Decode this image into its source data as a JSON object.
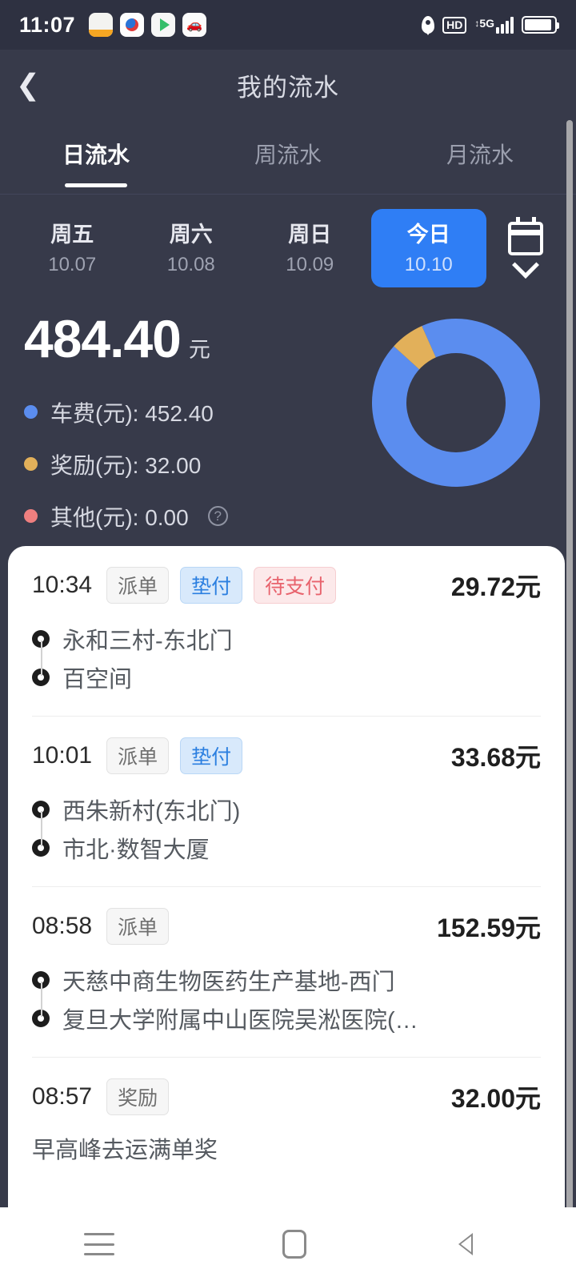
{
  "status_bar": {
    "time": "11:07",
    "app_icons": [
      "app-icon-1",
      "app-icon-2",
      "app-icon-3",
      "car-app-icon"
    ],
    "location_icon": "location-pin-icon",
    "hd_label": "HD",
    "network_label": "5G",
    "signal_icon": "signal-bars-icon",
    "battery_icon": "battery-icon"
  },
  "header": {
    "back_icon": "chevron-left-icon",
    "title": "我的流水"
  },
  "tabs": [
    {
      "label": "日流水",
      "active": true
    },
    {
      "label": "周流水",
      "active": false
    },
    {
      "label": "月流水",
      "active": false
    }
  ],
  "date_strip": {
    "days": [
      {
        "weekday": "周五",
        "date": "10.07",
        "selected": false
      },
      {
        "weekday": "周六",
        "date": "10.08",
        "selected": false
      },
      {
        "weekday": "周日",
        "date": "10.09",
        "selected": false
      },
      {
        "weekday": "今日",
        "date": "10.10",
        "selected": true
      }
    ],
    "calendar_icon": "calendar-icon",
    "expand_icon": "chevron-down-icon"
  },
  "summary": {
    "total_amount": "484.40",
    "total_unit": "元",
    "legend": [
      {
        "label": "车费(元): 452.40",
        "color": "#5b8def",
        "help": false
      },
      {
        "label": "奖励(元): 32.00",
        "color": "#e2b05a",
        "help": false
      },
      {
        "label": "其他(元): 0.00",
        "color": "#ef7f7f",
        "help": true
      }
    ],
    "help_icon": "help-circle-icon"
  },
  "chart_data": {
    "type": "pie",
    "title": "",
    "subtype": "donut",
    "labels": [
      "车费(元)",
      "奖励(元)",
      "其他(元)"
    ],
    "values": [
      452.4,
      32.0,
      0.0
    ],
    "percentages": [
      93.39,
      6.61,
      0.0
    ],
    "colors": [
      "#5b8def",
      "#e2b05a",
      "#ef7f7f"
    ],
    "total": 484.4,
    "unit": "元",
    "legend_position": "left",
    "inner_radius_ratio": 0.62,
    "start_angle_deg": -24
  },
  "orders": [
    {
      "time": "10:34",
      "tags": [
        {
          "text": "派单",
          "style": "gray"
        },
        {
          "text": "垫付",
          "style": "blue"
        },
        {
          "text": "待支付",
          "style": "red"
        }
      ],
      "amount": "29.72元",
      "origin": "永和三村-东北门",
      "destination": "百空间"
    },
    {
      "time": "10:01",
      "tags": [
        {
          "text": "派单",
          "style": "gray"
        },
        {
          "text": "垫付",
          "style": "blue"
        }
      ],
      "amount": "33.68元",
      "origin": "西朱新村(东北门)",
      "destination": "市北·数智大厦"
    },
    {
      "time": "08:58",
      "tags": [
        {
          "text": "派单",
          "style": "gray"
        }
      ],
      "amount": "152.59元",
      "origin": "天慈中商生物医药生产基地-西门",
      "destination": "复旦大学附属中山医院吴淞医院(…"
    },
    {
      "time": "08:57",
      "tags": [
        {
          "text": "奖励",
          "style": "gray"
        }
      ],
      "amount": "32.00元",
      "description": "早高峰去运满单奖"
    }
  ],
  "nav_bar": {
    "menu_icon": "menu-icon",
    "home_icon": "home-icon",
    "back_icon": "back-triangle-icon"
  }
}
